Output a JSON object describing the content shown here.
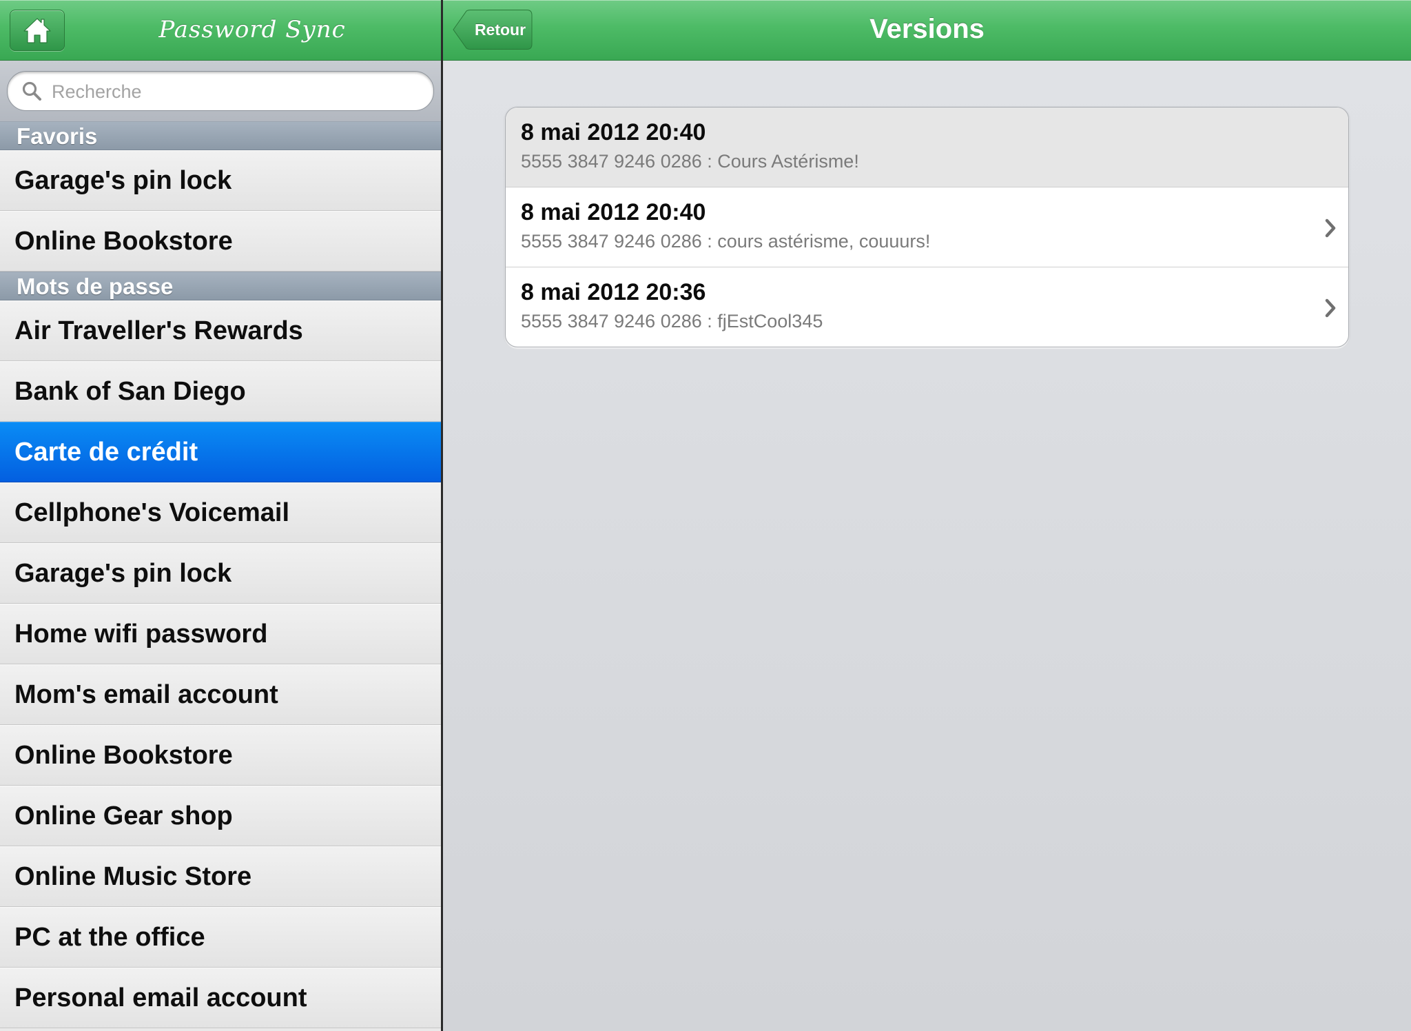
{
  "app": {
    "title": "Password Sync"
  },
  "sidebar": {
    "search": {
      "placeholder": "Recherche",
      "value": ""
    },
    "sections": [
      {
        "header": "Favoris",
        "items": [
          "Garage's pin lock",
          "Online Bookstore"
        ]
      },
      {
        "header": "Mots de passe",
        "items": [
          "Air Traveller's Rewards",
          "Bank of San Diego",
          "Carte de crédit",
          "Cellphone's Voicemail",
          "Garage's pin lock",
          "Home wifi password",
          "Mom's email account",
          "Online Bookstore",
          "Online Gear shop",
          "Online Music Store",
          "PC at the office",
          "Personal email account"
        ]
      }
    ],
    "selected_item": "Carte de crédit"
  },
  "detail": {
    "back_label": "Retour",
    "title": "Versions",
    "versions": [
      {
        "date": "8 mai 2012 20:40",
        "detail": "5555 3847 9246 0286 : Cours Astérisme!",
        "current": true
      },
      {
        "date": "8 mai 2012 20:40",
        "detail": "5555 3847 9246 0286 : cours astérisme, couuurs!",
        "current": false
      },
      {
        "date": "8 mai 2012 20:36",
        "detail": "5555 3847 9246 0286 : fjEstCool345",
        "current": false
      }
    ]
  },
  "colors": {
    "navbar_green": "#4dbb66",
    "selection_blue": "#0a7cf0",
    "section_header": "#98a5b3"
  },
  "icons": {
    "home": "home-icon",
    "search": "search-icon",
    "back": "back-arrow-button",
    "disclosure": "chevron-right-icon"
  }
}
